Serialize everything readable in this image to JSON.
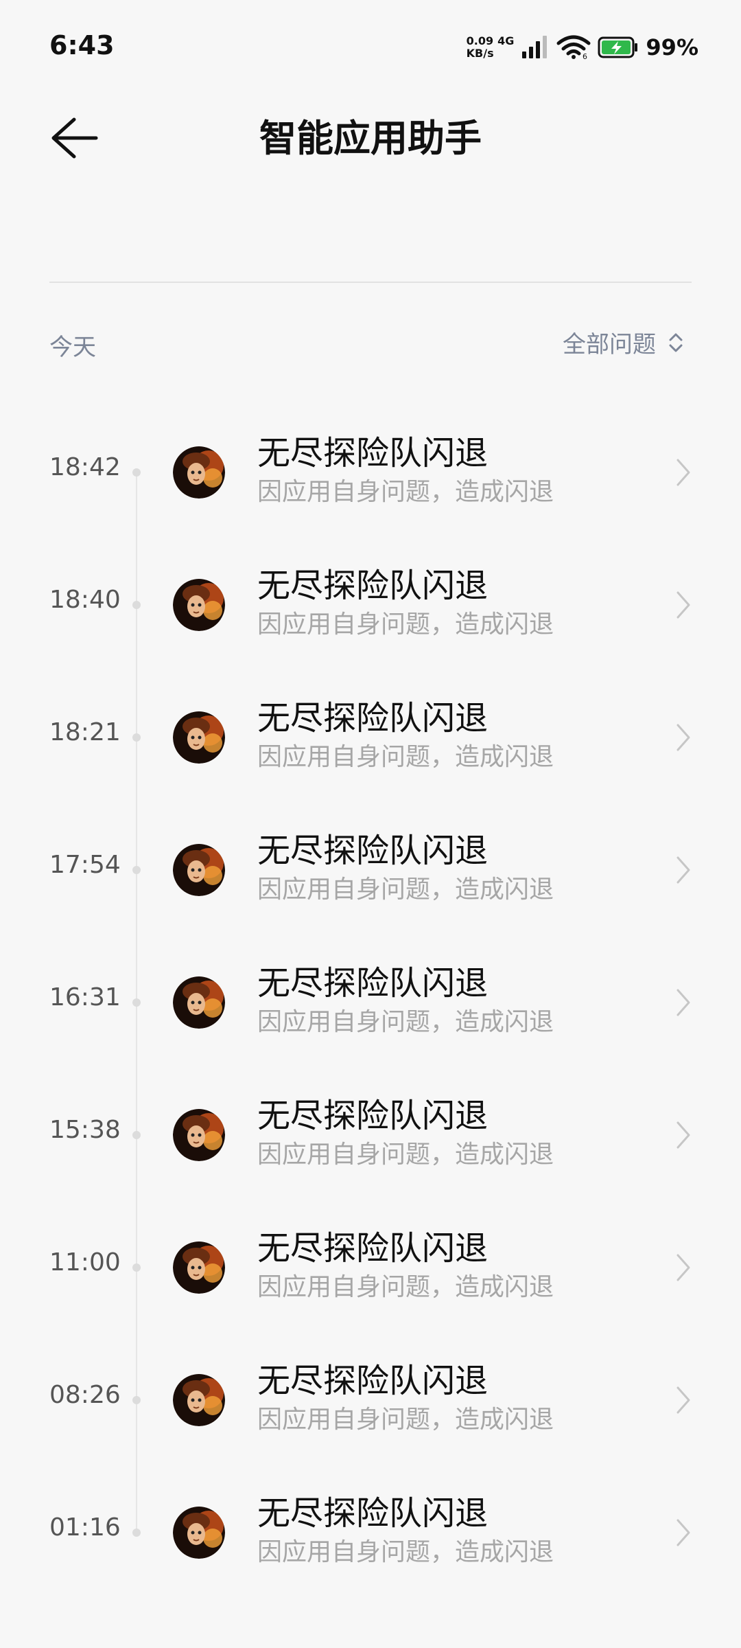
{
  "status_bar": {
    "time": "6:43",
    "net_speed_value": "0.09",
    "net_type": "4G",
    "net_speed_unit": "KB/s",
    "battery_percent": "99%"
  },
  "header": {
    "title": "智能应用助手",
    "back_icon": "back-arrow-icon"
  },
  "filter_bar": {
    "date_label": "今天",
    "filter_label": "全部问题",
    "filter_icon": "up-down-chevron-icon"
  },
  "events": [
    {
      "time": "18:42",
      "app_name": "无尽探险队闪退",
      "reason": "因应用自身问题，造成闪退"
    },
    {
      "time": "18:40",
      "app_name": "无尽探险队闪退",
      "reason": "因应用自身问题，造成闪退"
    },
    {
      "time": "18:21",
      "app_name": "无尽探险队闪退",
      "reason": "因应用自身问题，造成闪退"
    },
    {
      "time": "17:54",
      "app_name": "无尽探险队闪退",
      "reason": "因应用自身问题，造成闪退"
    },
    {
      "time": "16:31",
      "app_name": "无尽探险队闪退",
      "reason": "因应用自身问题，造成闪退"
    },
    {
      "time": "15:38",
      "app_name": "无尽探险队闪退",
      "reason": "因应用自身问题，造成闪退"
    },
    {
      "time": "11:00",
      "app_name": "无尽探险队闪退",
      "reason": "因应用自身问题，造成闪退"
    },
    {
      "time": "08:26",
      "app_name": "无尽探险队闪退",
      "reason": "因应用自身问题，造成闪退"
    },
    {
      "time": "01:16",
      "app_name": "无尽探险队闪退",
      "reason": "因应用自身问题，造成闪退"
    }
  ],
  "colors": {
    "background": "#f7f7f7",
    "muted_label": "#7c8597",
    "subtitle": "#a6a6a6",
    "battery_green": "#2fb84b"
  }
}
